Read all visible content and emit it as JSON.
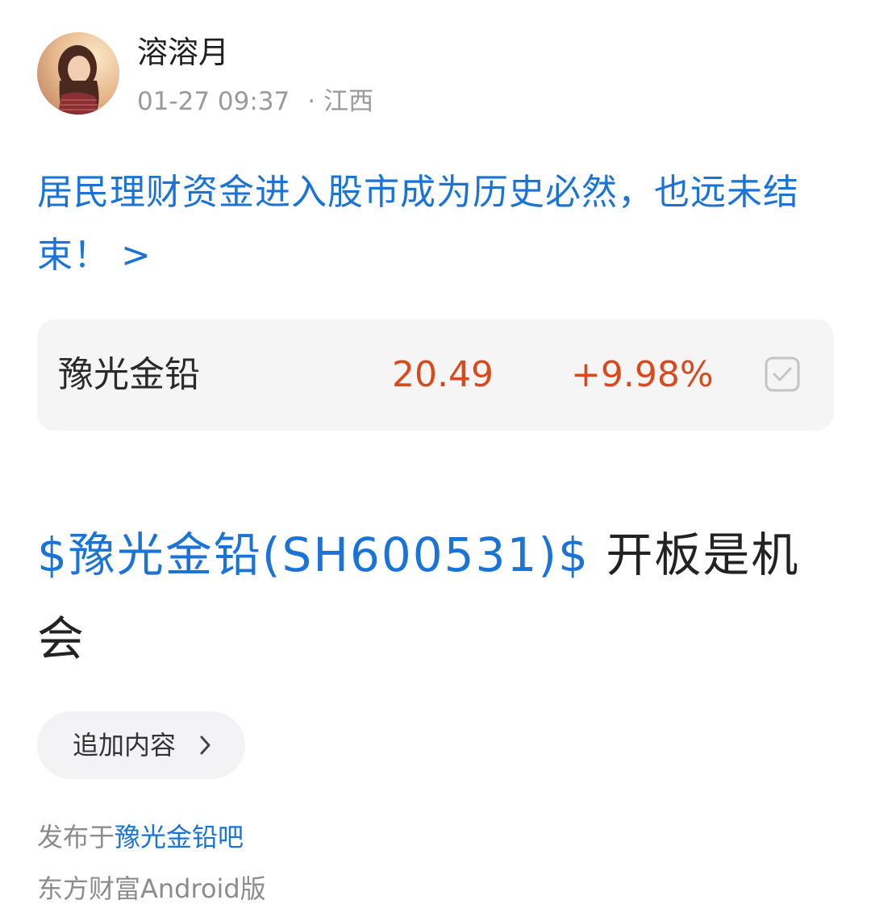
{
  "author": {
    "name": "溶溶月",
    "avatar_icon": "user-avatar-photo",
    "timestamp": "01-27 09:37",
    "separator": "·",
    "location": "江西"
  },
  "headline": {
    "text": "居民理财资金进入股市成为历史必然，也远未结束！",
    "chevron": ">"
  },
  "stock_card": {
    "name": "豫光金铅",
    "price": "20.49",
    "change": "+9.98%",
    "check_icon": "checkbox-checked-icon",
    "up_color": "#d8491c"
  },
  "post": {
    "tag_text": "$豫光金铅(SH600531)$",
    "body_text": " 开板是机会"
  },
  "add_content": {
    "label": "追加内容",
    "chevron_icon": "chevron-right-icon"
  },
  "footer": {
    "published_prefix": "发布于",
    "bar_name": "豫光金铅吧",
    "client": "东方财富Android版"
  },
  "colors": {
    "link_blue": "#1a73d6",
    "muted_gray": "#9a9a9a",
    "card_bg": "#f5f5f6"
  }
}
